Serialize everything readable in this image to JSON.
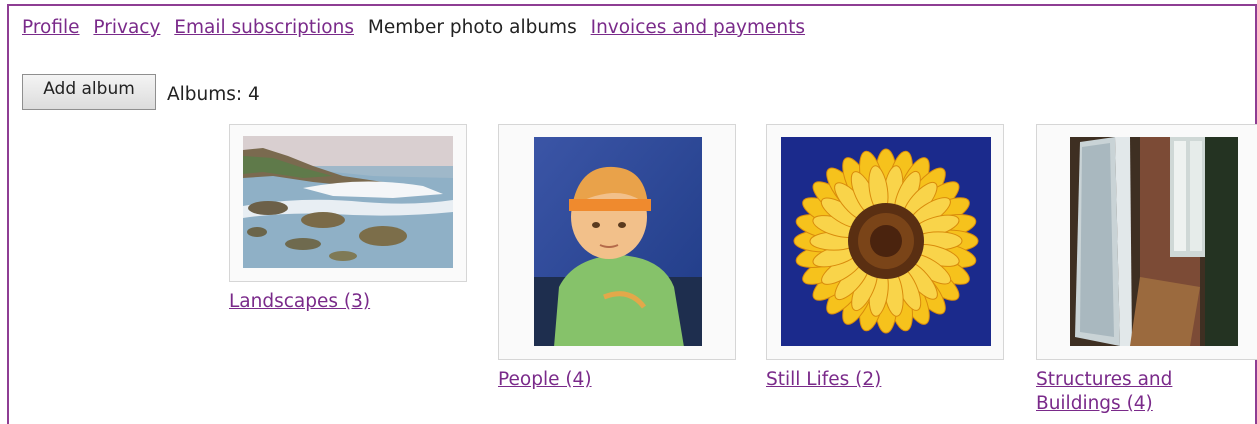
{
  "tabs": {
    "profile": "Profile",
    "privacy": "Privacy",
    "email_subscriptions": "Email subscriptions",
    "member_photo_albums": "Member photo albums",
    "invoices": "Invoices and payments"
  },
  "toolbar": {
    "add_album": "Add album",
    "albums_count": "Albums: 4"
  },
  "albums": [
    {
      "label": "Landscapes (3)"
    },
    {
      "label": "People (4)"
    },
    {
      "label": "Still Lifes (2)"
    },
    {
      "label_line1": "Structures and",
      "label_line2": "Buildings (4)"
    }
  ],
  "colors": {
    "frame_border": "#8e3d93",
    "link": "#7a2a8a"
  }
}
